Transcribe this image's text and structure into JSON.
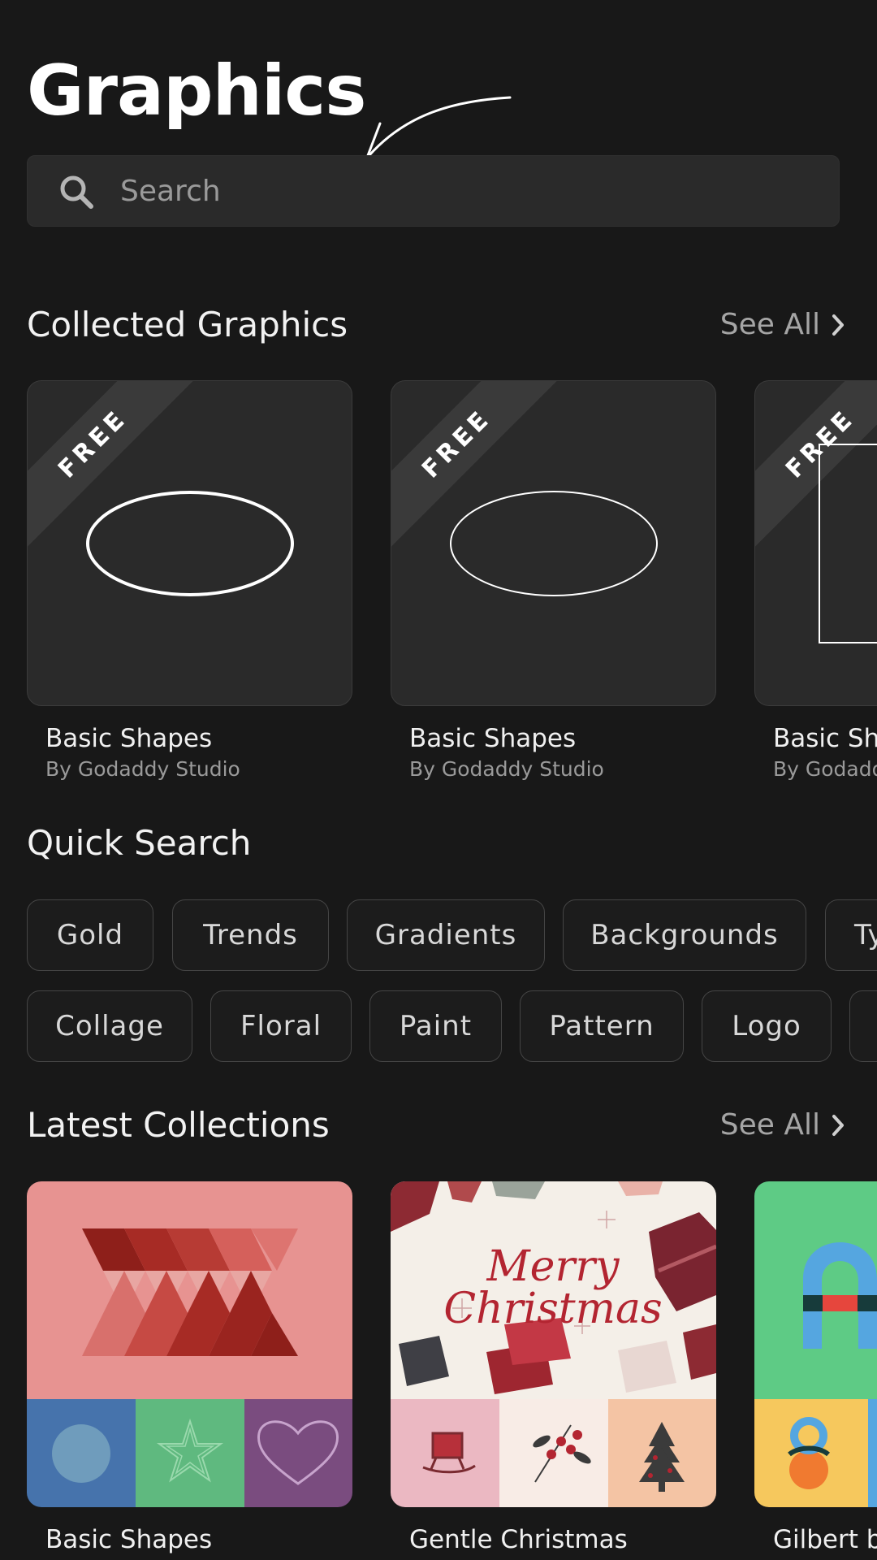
{
  "page": {
    "title": "Graphics"
  },
  "search": {
    "placeholder": "Search"
  },
  "collected": {
    "title": "Collected Graphics",
    "see_all": "See All",
    "items": [
      {
        "badge": "FREE",
        "name": "Basic Shapes",
        "author": "By Godaddy Studio"
      },
      {
        "badge": "FREE",
        "name": "Basic Shapes",
        "author": "By Godaddy Studio"
      },
      {
        "badge": "FREE",
        "name": "Basic Sha",
        "author": "By Godadd"
      }
    ]
  },
  "quick_search": {
    "title": "Quick Search",
    "row1": [
      "Gold",
      "Trends",
      "Gradients",
      "Backgrounds",
      "Ty"
    ],
    "row2": [
      "Collage",
      "Floral",
      "Paint",
      "Pattern",
      "Logo"
    ]
  },
  "latest": {
    "title": "Latest Collections",
    "see_all": "See All",
    "items": [
      {
        "name": "Basic Shapes"
      },
      {
        "name": "Gentle Christmas",
        "art_text_1": "Merry",
        "art_text_2": "Christmas"
      },
      {
        "name": "Gilbert b"
      }
    ]
  },
  "colors": {
    "background": "#181818",
    "card": "#2a2a2a",
    "shapes_pink": "#e79391",
    "shapes_blue": "#4673ac",
    "shapes_green": "#5fb97f",
    "shapes_purple": "#7a4c7f",
    "gilbert_green": "#5ecb85"
  },
  "icons": [
    "search-icon",
    "chevron-right-icon",
    "annotation-arrow"
  ]
}
